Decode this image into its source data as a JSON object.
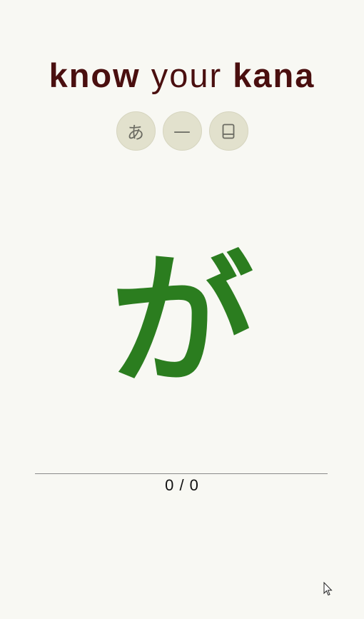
{
  "header": {
    "title_part1": "know",
    "title_part2": "your",
    "title_part3": "kana"
  },
  "controls": [
    {
      "name": "kana-mode-button",
      "icon": "hiragana-a-icon",
      "glyph": "あ"
    },
    {
      "name": "long-vowel-button",
      "icon": "dash-icon",
      "glyph": "—"
    },
    {
      "name": "dictionary-button",
      "icon": "book-icon",
      "glyph": ""
    }
  ],
  "quiz": {
    "current_kana": "が",
    "score": "0 / 0"
  },
  "colors": {
    "background": "#f8f8f3",
    "title": "#4a0f0f",
    "kana": "#2b7d1f",
    "button_bg": "#e2e1cd"
  }
}
